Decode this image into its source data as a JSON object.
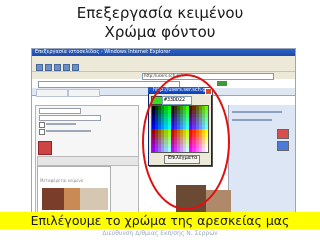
{
  "slide": {
    "title_line1": "Επεξεργασία κειμένου",
    "title_line2": "Χρώμα φόντου",
    "caption": "Επιλέγουμε το χρώμα της αρεσκείας μας",
    "footer": "Διεύθυνση Δ/θμιας Εκπ/σης Ν. Σερρών"
  },
  "browser": {
    "window_title": "Επεξεργασία ιστοσελίδας - Windows Internet Explorer",
    "address": "http://users.sch.gr/...",
    "address2": "http://users.sch.gr/...",
    "toolbar_icons": [
      "back-icon",
      "forward-icon",
      "stop-icon",
      "refresh-icon",
      "home-icon"
    ]
  },
  "editor": {
    "area_label": "Μεταφέρεται κείμενο"
  },
  "color_dialog": {
    "title": "http://users.ser.sch.gr",
    "hex_value": "#33DD22",
    "selected_color": "#33dd22",
    "ok_label": "Επιλέγματα"
  },
  "colors": {
    "highlight": "#e01010",
    "caption_band": "#ffff00"
  }
}
